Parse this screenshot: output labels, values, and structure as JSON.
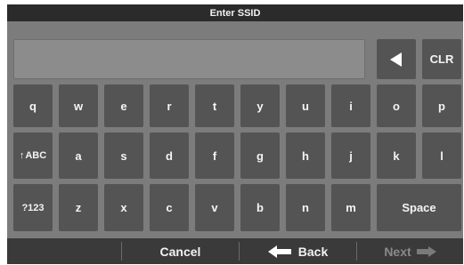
{
  "title": "Enter SSID",
  "ssid_field": {
    "value": ""
  },
  "keys": {
    "backspace_icon": "backspace-triangle-icon",
    "clear": "CLR",
    "row1": [
      "q",
      "w",
      "e",
      "r",
      "t",
      "y",
      "u",
      "i",
      "o",
      "p"
    ],
    "shift_arrow": "↑",
    "shift_label": "ABC",
    "row2": [
      "a",
      "s",
      "d",
      "f",
      "g",
      "h",
      "j",
      "k",
      "l"
    ],
    "numbers": "?123",
    "row3": [
      "z",
      "x",
      "c",
      "v",
      "b",
      "n",
      "m"
    ],
    "space": "Space"
  },
  "bottom_bar": {
    "cancel": "Cancel",
    "back": "Back",
    "back_icon": "left-arrow-icon",
    "next": "Next",
    "next_icon": "right-arrow-icon",
    "next_enabled": false
  },
  "colors": {
    "background": "#7c7c7c",
    "key": "#545454",
    "title_bar": "#2b2b2b",
    "bottom_bar": "#3a3a3a"
  }
}
